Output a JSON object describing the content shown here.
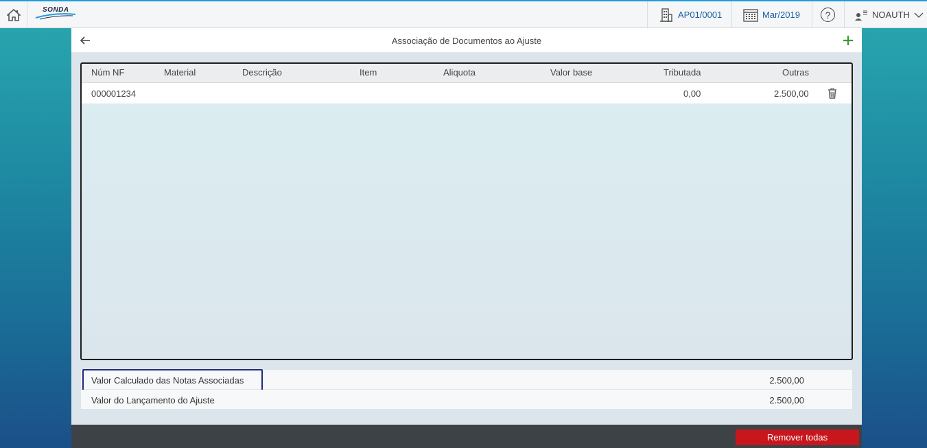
{
  "topbar": {
    "logo_text": "SONDA",
    "company": "AP01/0001",
    "period": "Mar/2019",
    "help_label": "?",
    "user": "NOAUTH"
  },
  "panel": {
    "title": "Associação de Documentos ao Ajuste"
  },
  "table": {
    "headers": [
      "Núm NF",
      "Material",
      "Descrição",
      "Item",
      "Aliquota",
      "Valor base",
      "Tributada",
      "Outras"
    ],
    "rows": [
      {
        "num_nf": "000001234",
        "material": "",
        "descricao": "",
        "item": "",
        "aliquota": "",
        "valor_base": "",
        "tributada": "0,00",
        "outras": "2.500,00"
      }
    ]
  },
  "summary": {
    "calc_label": "Valor Calculado das Notas Associadas",
    "calc_value": "2.500,00",
    "lanc_label": "Valor do Lançamento do Ajuste",
    "lanc_value": "2.500,00"
  },
  "footer": {
    "remove_all_label": "Remover todas"
  },
  "colors": {
    "accent": "#1e9be0",
    "link": "#1a5fa8",
    "danger": "#c8161d",
    "add": "#3a9a2e"
  }
}
